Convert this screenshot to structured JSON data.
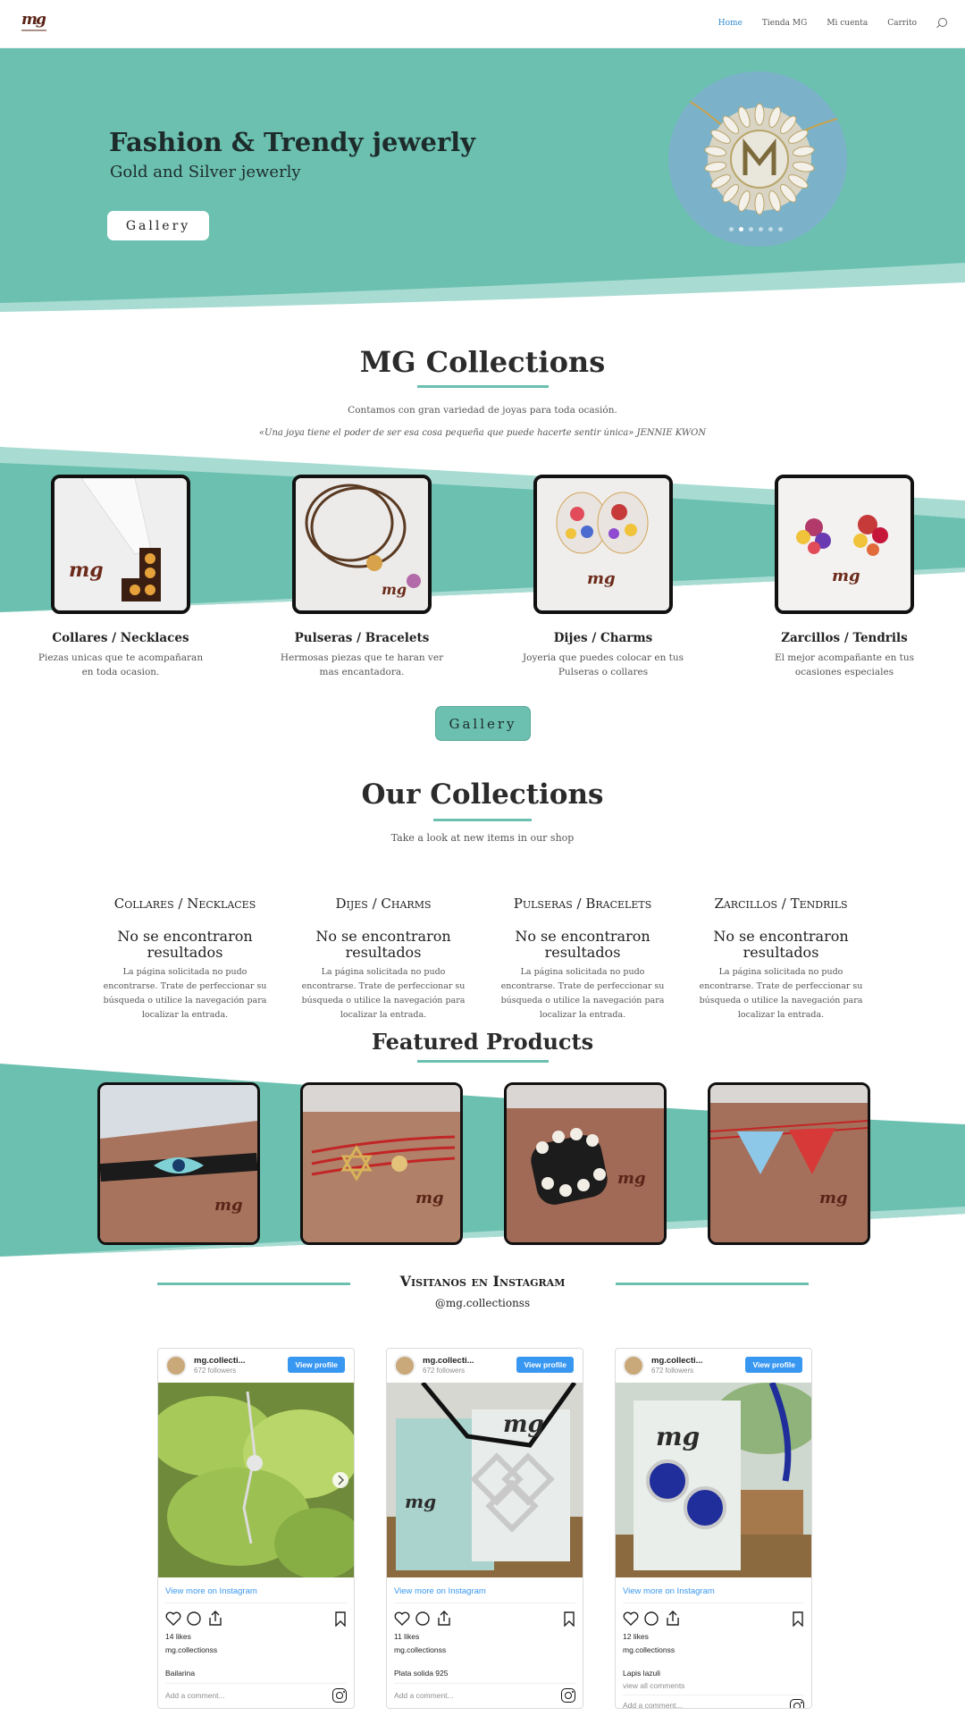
{
  "header": {
    "nav": [
      "Home",
      "Tienda MG",
      "Mi cuenta",
      "Carrito"
    ],
    "active": "Home",
    "logo_text": "mg"
  },
  "hero": {
    "title": "Fashion & Trendy jewerly",
    "subtitle": "Gold and Silver jewerly",
    "button": "Gallery",
    "slides": 6,
    "active_slide": 2
  },
  "mg_collections": {
    "title": "MG Collections",
    "text": "Contamos con gran variedad de joyas para toda ocasión.",
    "quote": "«Una joya tiene el poder de ser esa cosa pequeña que puede hacerte sentir única» JENNIE KWON",
    "categories": [
      {
        "name": "Collares / Necklaces",
        "desc": "Piezas unicas que te acompañaran en toda ocasion."
      },
      {
        "name": "Pulseras / Bracelets",
        "desc": "Hermosas piezas que te haran ver mas encantadora."
      },
      {
        "name": "Dijes / Charms",
        "desc": "Joyeria que puedes colocar en tus Pulseras o collares"
      },
      {
        "name": "Zarcillos / Tendrils",
        "desc": "El mejor acompañante en tus ocasiones especiales"
      }
    ],
    "gallery_button": "Gallery"
  },
  "our_collections": {
    "title": "Our Collections",
    "subtitle": "Take a look at new items in our shop",
    "columns": [
      {
        "heading": "Collares / Necklaces",
        "notfound": "No se encontraron resultados",
        "text": "La página solicitada no pudo encontrarse. Trate de perfeccionar su búsqueda o utilice la navegación para localizar la entrada."
      },
      {
        "heading": "Dijes / Charms",
        "notfound": "No se encontraron resultados",
        "text": "La página solicitada no pudo encontrarse. Trate de perfeccionar su búsqueda o utilice la navegación para localizar la entrada."
      },
      {
        "heading": "Pulseras / Bracelets",
        "notfound": "No se encontraron resultados",
        "text": "La página solicitada no pudo encontrarse. Trate de perfeccionar su búsqueda o utilice la navegación para localizar la entrada."
      },
      {
        "heading": "Zarcillos / Tendrils",
        "notfound": "No se encontraron resultados",
        "text": "La página solicitada no pudo encontrarse. Trate de perfeccionar su búsqueda o utilice la navegación para localizar la entrada."
      }
    ]
  },
  "featured": {
    "title": "Featured Products"
  },
  "instagram": {
    "title": "Visitanos en Instagram",
    "handle": "@mg.collectionss",
    "posts": [
      {
        "user": "mg.collecti...",
        "followers": "672 followers",
        "view_btn": "View profile",
        "more": "View more on Instagram",
        "likes": "14 likes",
        "owner": "mg.collectionss",
        "caption": "Bailarina",
        "view_all": "",
        "comment_placeholder": "Add a comment..."
      },
      {
        "user": "mg.collecti...",
        "followers": "672 followers",
        "view_btn": "View profile",
        "more": "View more on Instagram",
        "likes": "11 likes",
        "owner": "mg.collectionss",
        "caption": "Plata solida 925",
        "view_all": "",
        "comment_placeholder": "Add a comment..."
      },
      {
        "user": "mg.collecti...",
        "followers": "672 followers",
        "view_btn": "View profile",
        "more": "View more on Instagram",
        "likes": "12 likes",
        "owner": "mg.collectionss",
        "caption": "Lapis lazuli",
        "view_all": "view all comments",
        "comment_placeholder": "Add a comment..."
      }
    ]
  },
  "colors": {
    "accent": "#6cc0b0",
    "nav_active": "#2e8bd1",
    "ig_blue": "#3897f0"
  }
}
